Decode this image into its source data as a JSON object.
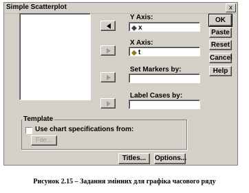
{
  "window": {
    "title": "Simple Scatterplot",
    "close_glyph": "x"
  },
  "fields": {
    "y_axis": {
      "label": "Y Axis:",
      "value": "x"
    },
    "x_axis": {
      "label": "X Axis:",
      "value": "t"
    },
    "markers": {
      "label": "Set Markers by:",
      "value": ""
    },
    "label_cases": {
      "label": "Label Cases by:",
      "value": ""
    }
  },
  "buttons": {
    "ok": "OK",
    "paste": "Paste",
    "reset": "Reset",
    "cancel": "Cancel",
    "help": "Help",
    "titles": "Titles...",
    "options": "Options...",
    "file": "File..."
  },
  "template": {
    "group_label": "Template",
    "checkbox_label": "Use chart specifications from:",
    "checked": false
  },
  "caption": "Рисунок 2.15 – Задання змінних для графіка часового ряду"
}
